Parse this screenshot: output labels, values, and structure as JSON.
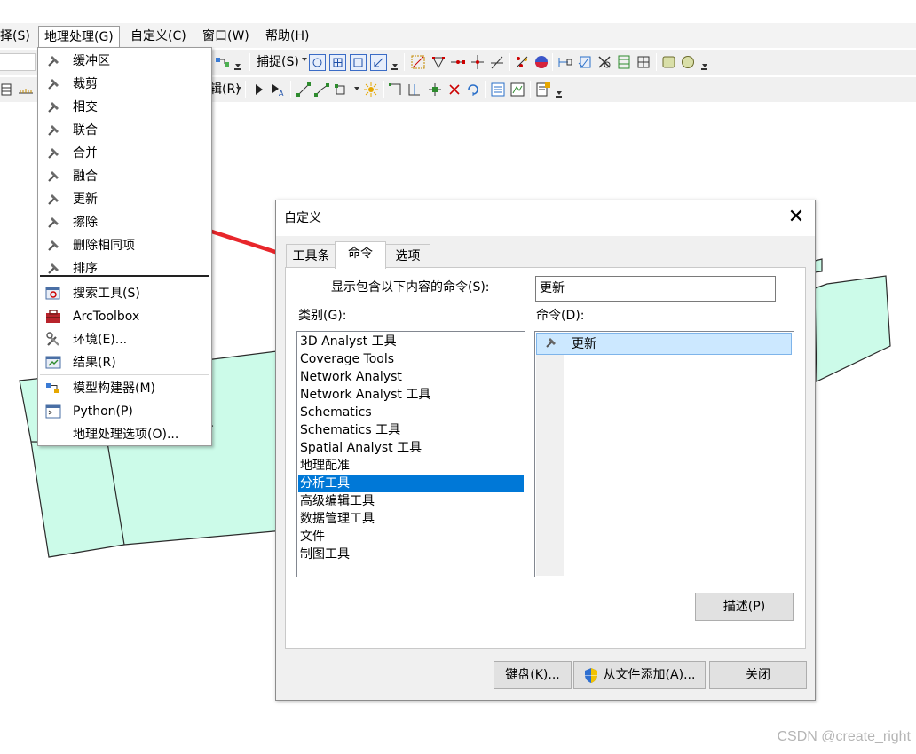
{
  "colors": {
    "polygon_fill": "#ccfbe9",
    "polygon_stroke": "#2b2b2b",
    "selection": "#0078d7",
    "arrow": "#e8262b"
  },
  "menubar": {
    "items": [
      "择(S)",
      "地理处理(G)",
      "自定义(C)",
      "窗口(W)",
      "帮助(H)"
    ]
  },
  "toolbar": {
    "snapping_label": "捕捉(S)",
    "editor_suffix": "辑(R)"
  },
  "geoprocessing_menu": {
    "tool_items": [
      {
        "label": "缓冲区",
        "icon": "hammer-icon"
      },
      {
        "label": "裁剪",
        "icon": "hammer-icon"
      },
      {
        "label": "相交",
        "icon": "hammer-icon"
      },
      {
        "label": "联合",
        "icon": "hammer-icon"
      },
      {
        "label": "合并",
        "icon": "hammer-icon"
      },
      {
        "label": "融合",
        "icon": "hammer-icon"
      },
      {
        "label": "更新",
        "icon": "hammer-icon"
      },
      {
        "label": "擦除",
        "icon": "hammer-icon"
      },
      {
        "label": "删除相同项",
        "icon": "hammer-icon"
      },
      {
        "label": "排序",
        "icon": "hammer-icon"
      }
    ],
    "search_tools": "搜索工具(S)",
    "arctoolbox": "ArcToolbox",
    "environments": "环境(E)...",
    "results": "结果(R)",
    "model_builder": "模型构建器(M)",
    "python": "Python(P)",
    "gp_options": "地理处理选项(O)..."
  },
  "dialog": {
    "title": "自定义",
    "close_glyph": "✕",
    "tabs": [
      "工具条",
      "命令",
      "选项"
    ],
    "active_tab": "命令",
    "search_label": "显示包含以下内容的命令(S):",
    "search_value": "更新",
    "categories_label": "类别(G):",
    "commands_label": "命令(D):",
    "categories": [
      "3D Analyst 工具",
      "Coverage Tools",
      "Network Analyst",
      "Network Analyst 工具",
      "Schematics",
      "Schematics 工具",
      "Spatial Analyst 工具",
      "地理配准",
      "分析工具",
      "高级编辑工具",
      "数据管理工具",
      "文件",
      "制图工具"
    ],
    "selected_category": "分析工具",
    "commands": [
      {
        "label": "更新",
        "icon": "hammer-icon"
      }
    ],
    "describe_button": "描述(P)",
    "keyboard_button": "键盘(K)...",
    "add_from_file_button": "从文件添加(A)...",
    "close_button": "关闭"
  },
  "watermark": "CSDN @create_right"
}
